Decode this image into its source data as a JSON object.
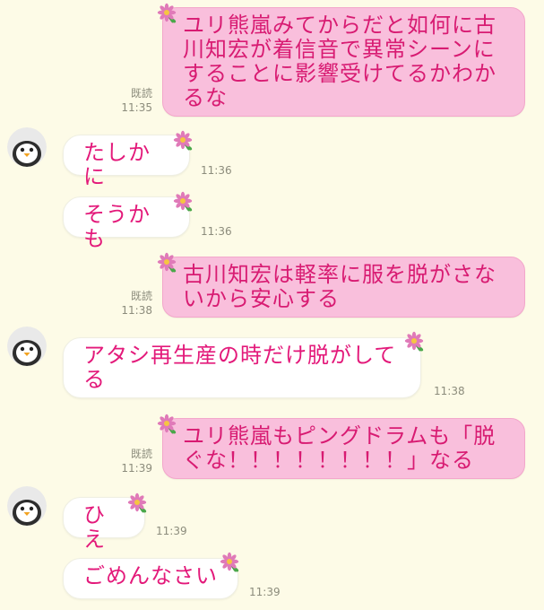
{
  "chat": {
    "messages": [
      {
        "id": "m1",
        "direction": "outgoing",
        "text": "ユリ熊嵐みてからだと如何に古川知宏が着信音で異常シーンにすることに影響受けてるかわかるな",
        "read_label": "既読",
        "time": "11:35"
      },
      {
        "id": "m2",
        "direction": "incoming",
        "text": "たしかに",
        "time": "11:36"
      },
      {
        "id": "m3",
        "direction": "incoming",
        "text": "そうかも",
        "time": "11:36"
      },
      {
        "id": "m4",
        "direction": "outgoing",
        "text": "古川知宏は軽率に服を脱がさないから安心する",
        "read_label": "既読",
        "time": "11:38"
      },
      {
        "id": "m5",
        "direction": "incoming",
        "text": "アタシ再生産の時だけ脱がしてる",
        "time": "11:38"
      },
      {
        "id": "m6",
        "direction": "outgoing",
        "text": "ユリ熊嵐もピングドラムも「脱ぐな！！！！！！！！」なる",
        "read_label": "既読",
        "time": "11:39"
      },
      {
        "id": "m7",
        "direction": "incoming",
        "text": "ひえ",
        "time": "11:39"
      },
      {
        "id": "m8",
        "direction": "incoming",
        "text": "ごめんなさい",
        "time": "11:39"
      }
    ],
    "icons": {
      "avatar": "penguin-avatar-icon",
      "sticker": "flower-icon"
    },
    "colors": {
      "background": "#fdfbe7",
      "outgoing_bubble": "#f9bfdc",
      "outgoing_text": "#d81b72",
      "incoming_bubble": "#ffffff",
      "incoming_text": "#e3197a",
      "meta_text": "#8c8c7c"
    }
  }
}
